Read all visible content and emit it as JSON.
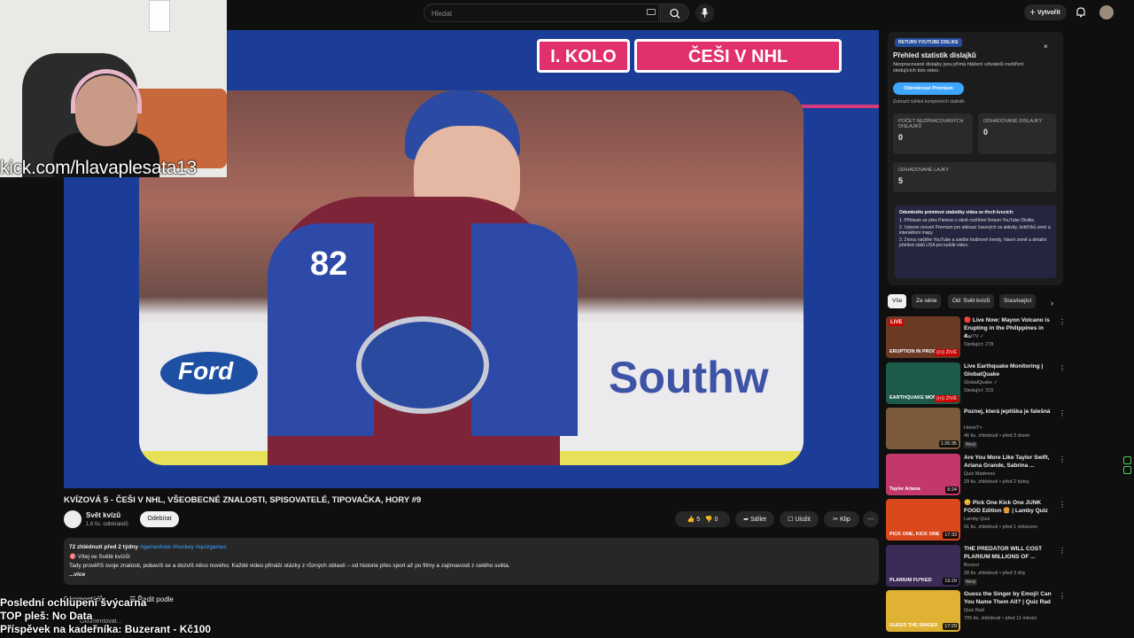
{
  "topbar": {
    "search_placeholder": "Hledat",
    "create_label": "Vytvořit"
  },
  "stream_overlay": {
    "kick_url": "kick.com/hlavaplesata13",
    "line1": "Poslední ochlupení švýcarna",
    "line2": "TOP pleš: No Data",
    "line3": "Příspěvek na kadeřníka: Buzerant - Kč100"
  },
  "player": {
    "round_label": "I. KOLO",
    "topic_label": "ČEŠI V NHL",
    "jersey_number": "82",
    "ford_text": "Ford",
    "sponsor_text": "Southw"
  },
  "video": {
    "title": "KVÍZOVÁ 5 - ČEŠI V NHL, VŠEOBECNÉ ZNALOSTI, SPISOVATELÉ, TIPOVAČKA, HORY #9",
    "channel_name": "Svět kvízů",
    "subscribers": "1,6 tis. odběratelů",
    "subscribe_label": "Odebírat",
    "likes": "5",
    "dislikes": "0",
    "share_label": "Sdílet",
    "save_label": "Uložit",
    "clip_label": "Klip"
  },
  "description": {
    "meta": "72 zhlédnutí  před 2 týdny",
    "tags": "#gameshow #hockey #quizgames",
    "line1": "🎯 Vítej ve Světě kvízů!",
    "line2": "Tady prověříš svoje znalosti, pobavíš se a dozvíš něco nového. Každé video přináší otázky z různých oblastí – od historie přes sport až po filmy a zajímavosti z celého světa.",
    "more": "...více"
  },
  "comments": {
    "header": "0 komentářů",
    "sort_label": "Řadit podle",
    "placeholder": "Okomentovat..."
  },
  "ryd_panel": {
    "tag": "RETURN YOUTUBE DISLIKE",
    "title": "Přehled statistik dislajků",
    "subtitle": "Nezpracované dislajky jsou přímá hlášení uživatelů rozšíření sledujících toto video.",
    "unlock_label": "Odemknout Premium",
    "link": "Zobrazit náhled kompletních statistik",
    "raw_dislikes_label": "POČET NEZPRACOVANÝCH DISLAJKŮ",
    "raw_dislikes_value": "0",
    "est_dislikes_label": "ODHADOVANÉ DISLAJKY",
    "est_dislikes_value": "0",
    "est_likes_label": "ODHADOVANÉ LAJKY",
    "est_likes_value": "5",
    "steps_heading": "Odemkněte prémiové statistiky videa ve třech krocích:",
    "step1": "1. Přihlaste se přes Patreon v okně rozšíření Return YouTube Dislike.",
    "step2": "2. Vyberte úroveň Premium pro aktivaci časových os aktivity, žebříčků zemí a interaktivní mapy.",
    "step3": "3. Znovu načtěte YouTube a uvidíte hodinové trendy, hlavní země a detailní přehled států USA pro každé video."
  },
  "chips": [
    "Vše",
    "Ze série",
    "Od: Svět kvízů",
    "Související"
  ],
  "recommendations": [
    {
      "title": "🔴 Live Now: Mayon Volcano is Erupting in the Philippines in 4...",
      "channel": "afarTV ✓",
      "views": "Sledující: 278",
      "duration": "((•)) ŽIVĚ",
      "thumb_text": "ERUPTION IN PROGRESS",
      "thumb_color": "#6b3a24",
      "live_label": "LIVE"
    },
    {
      "title": "Live Earthquake Monitoring | GlobalQuake",
      "channel": "GlobalQuake ✓",
      "views": "Sledující: 315",
      "duration": "((•)) ŽIVĚ",
      "thumb_text": "EARTHQUAKE MONITOR",
      "thumb_color": "#1d5a4a"
    },
    {
      "title": "Poznej, která jeptiška je falešná",
      "channel": "HeiseT+",
      "views": "46 tis. zhlédnutí • před 3 dnem",
      "duration": "1:26:35",
      "thumb_text": "",
      "thumb_color": "#7a5a3a",
      "badge": "Nový"
    },
    {
      "title": "Are You More Like Taylor Swift, Ariana Grande, Sabrina ...",
      "channel": "Quiz Madness",
      "views": "29 tis. zhlédnutí • před 2 týdny",
      "duration": "8:24",
      "thumb_text": "Taylor  Ariana",
      "thumb_color": "#c2386b"
    },
    {
      "title": "😋 Pick One Kick One JUNK FOOD Edition 🍔 | Lamby Quiz",
      "channel": "Lamby Quiz",
      "views": "91 tis. zhlédnutí • před 1 měsícem",
      "duration": "17:33",
      "thumb_text": "PICK ONE, KICK ONE",
      "thumb_color": "#d9471c"
    },
    {
      "title": "THE PREDATOR WILL COST PLARIUM MILLIONS OF ...",
      "channel": "Boozor",
      "views": "28 tis. zhlédnutí • před 3 dny",
      "duration": "19:29",
      "thumb_text": "PLARIUM FU*KED",
      "thumb_color": "#3c2a57",
      "badge": "Nový"
    },
    {
      "title": "Guess the Singer by Emoji! Can You Name Them All? | Quiz Rad",
      "channel": "Quiz Rad",
      "views": "705 tis. zhlédnutí • před 11 měsíci",
      "duration": "17:29",
      "thumb_text": "GUESS THE SINGER",
      "thumb_color": "#e0b233"
    }
  ]
}
